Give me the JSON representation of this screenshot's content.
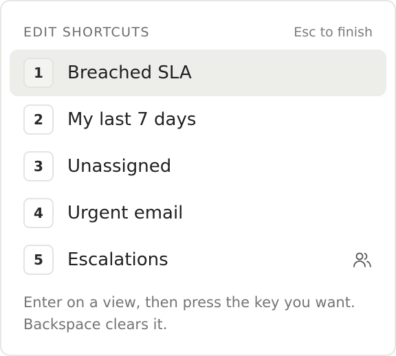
{
  "header": {
    "title": "EDIT SHORTCUTS",
    "hint": "Esc to finish"
  },
  "shortcuts": [
    {
      "key": "1",
      "label": "Breached SLA",
      "active": true,
      "shared": false
    },
    {
      "key": "2",
      "label": "My last 7 days",
      "active": false,
      "shared": false
    },
    {
      "key": "3",
      "label": "Unassigned",
      "active": false,
      "shared": false
    },
    {
      "key": "4",
      "label": "Urgent email",
      "active": false,
      "shared": false
    },
    {
      "key": "5",
      "label": "Escalations",
      "active": false,
      "shared": true,
      "icon": "users-icon"
    }
  ],
  "footer": {
    "line1": "Enter on a view, then press the key you want.",
    "line2": "Backspace clears it."
  },
  "colors": {
    "active_row_bg": "#edeeea",
    "border": "#e6e6e3",
    "muted_text": "#747474"
  }
}
